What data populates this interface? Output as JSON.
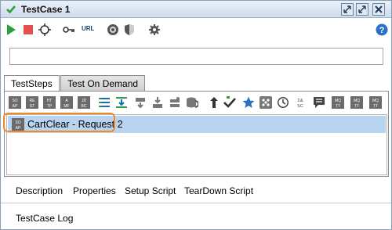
{
  "window": {
    "title": "TestCase 1"
  },
  "toolbar": {
    "icons": [
      "run-icon",
      "stop-icon",
      "options-icon",
      "key-icon",
      "url-icon",
      "status-icon",
      "security-icon",
      "settings-icon",
      "help-icon"
    ],
    "url_label": "URL"
  },
  "search": {
    "value": "",
    "placeholder": ""
  },
  "tabs": [
    {
      "label": "TestSteps",
      "active": true
    },
    {
      "label": "Test On Demand",
      "active": false
    }
  ],
  "steps": [
    {
      "label": "CartClear - Request 2",
      "selected": true
    }
  ],
  "bottom_tabs": [
    {
      "label": "Description"
    },
    {
      "label": "Properties"
    },
    {
      "label": "Setup Script"
    },
    {
      "label": "TearDown Script"
    }
  ],
  "log": {
    "label": "TestCase Log"
  },
  "colors": {
    "accent": "#f08a24",
    "selection": "#b9d4f0",
    "run": "#2e9e3e",
    "stop": "#e35050"
  }
}
